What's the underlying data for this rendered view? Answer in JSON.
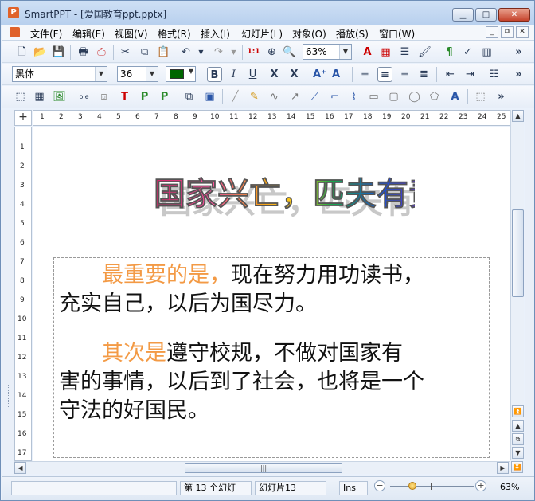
{
  "window": {
    "title": "SmartPPT - [爱国教育ppt.pptx]",
    "app_icon_letter": "P"
  },
  "title_buttons": {
    "minimize": "▁",
    "maximize": "□",
    "close": "✕"
  },
  "menu": {
    "items": [
      "文件(F)",
      "编辑(E)",
      "视图(V)",
      "格式(R)",
      "插入(I)",
      "幻灯片(L)",
      "对象(O)",
      "播放(S)",
      "窗口(W)"
    ],
    "mdi_buttons": [
      "_",
      "⧉",
      "✕"
    ]
  },
  "toolbar1": {
    "zoom_value": "63%",
    "more": "»"
  },
  "toolbar2": {
    "font_name": "黑体",
    "font_size": "36",
    "font_color": "#006600",
    "bold": "B",
    "italic": "I",
    "underline": "U",
    "strike": "X",
    "more": "»"
  },
  "toolbar3": {
    "more": "»"
  },
  "ruler": {
    "corner": "+",
    "h_ticks": [
      "1",
      "2",
      "3",
      "4",
      "5",
      "6",
      "7",
      "8",
      "9",
      "10",
      "11",
      "12",
      "13",
      "14",
      "15",
      "16",
      "17",
      "18",
      "19",
      "20",
      "21",
      "22",
      "23",
      "24",
      "25"
    ],
    "v_ticks": [
      "1",
      "2",
      "3",
      "4",
      "5",
      "6",
      "7",
      "8",
      "9",
      "10",
      "11",
      "12",
      "13",
      "14",
      "15",
      "16",
      "17"
    ]
  },
  "slide": {
    "wordart_title": "国家兴亡，匹夫有责",
    "paragraph1": {
      "highlight": "最重要的是，",
      "line1_rest": "现在努力用功读书，",
      "line2": "充实自己，以后为国尽力。"
    },
    "paragraph2": {
      "highlight": "其次是",
      "line1_rest": "遵守校规，不做对国家有",
      "line2": "害的事情，以后到了社会，也将是一个",
      "line3": "守法的好国民。"
    },
    "highlight_color": "#f39a45"
  },
  "status": {
    "pane1": "",
    "slide_count": "第 13 个幻灯",
    "current_slide": "幻灯片13",
    "ins": "Ins",
    "zoom_minus": "−",
    "zoom_plus": "+",
    "zoom": "63%"
  }
}
